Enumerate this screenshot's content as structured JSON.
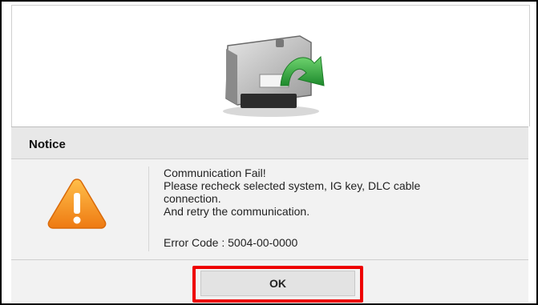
{
  "dialog": {
    "title": "Notice",
    "icon": "warning-icon",
    "message_lines": [
      "Communication Fail!",
      "Please recheck selected system, IG key, DLC cable",
      "connection.",
      "And retry the communication."
    ],
    "error_code": "Error Code : 5004-00-0000",
    "ok_label": "OK"
  },
  "illustration": {
    "icon": "ecu-module-icon",
    "arrow_icon": "green-curved-arrow-icon"
  },
  "colors": {
    "highlight": "#ee0000",
    "warning": "#f39a1e",
    "arrow": "#2e9e3c"
  }
}
